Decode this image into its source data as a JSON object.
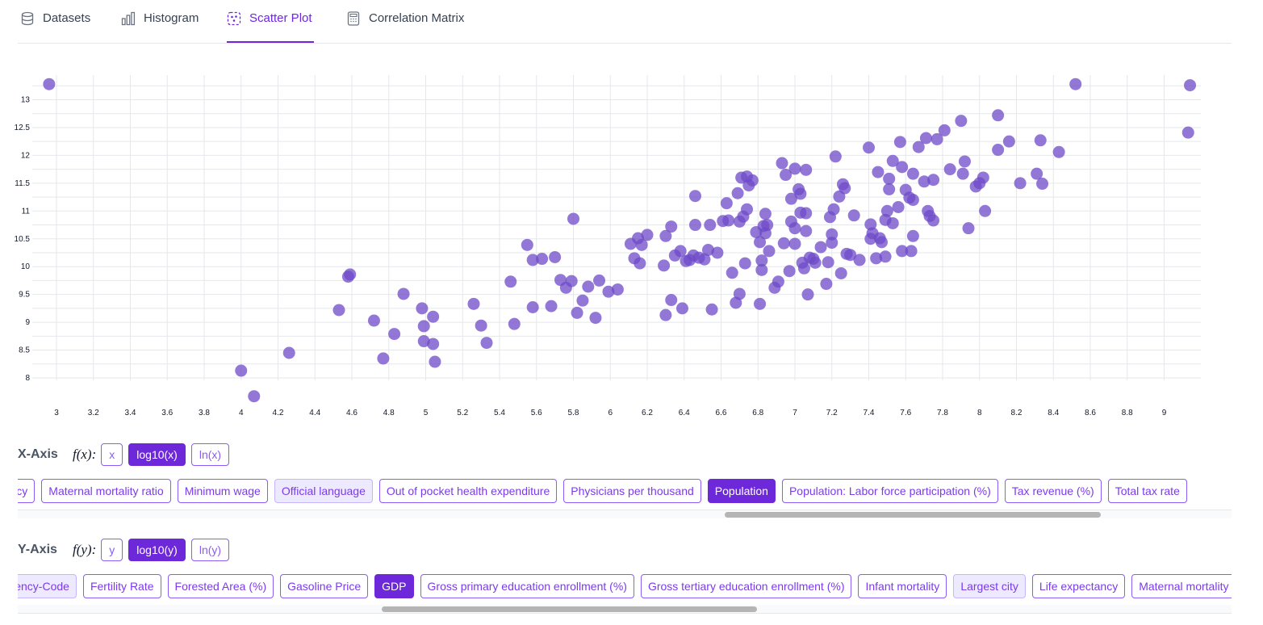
{
  "tabs": [
    {
      "label": "Datasets",
      "icon": "database-icon"
    },
    {
      "label": "Histogram",
      "icon": "bar-chart-icon"
    },
    {
      "label": "Scatter Plot",
      "icon": "scatter-plot-icon",
      "active": true
    },
    {
      "label": "Correlation Matrix",
      "icon": "calculator-icon"
    }
  ],
  "colors": {
    "accent": "#6d28d9",
    "point": "#6d4ac8",
    "chip_border": "#8b5cf6"
  },
  "chart_data": {
    "type": "scatter",
    "title": "",
    "xlabel": "",
    "ylabel": "",
    "xlim": [
      2.95,
      9.15
    ],
    "ylim": [
      7.55,
      13.35
    ],
    "grid": true,
    "x_ticks": [
      "3",
      "3.2",
      "3.4",
      "3.6",
      "3.8",
      "4",
      "4.2",
      "4.4",
      "4.6",
      "4.8",
      "5",
      "5.2",
      "5.4",
      "5.6",
      "5.8",
      "6",
      "6.2",
      "6.4",
      "6.6",
      "6.8",
      "7",
      "7.2",
      "7.4",
      "7.6",
      "7.8",
      "8",
      "8.2",
      "8.4",
      "8.6",
      "8.8",
      "9"
    ],
    "y_ticks": [
      "8",
      "8.5",
      "9",
      "9.5",
      "10",
      "10.5",
      "11",
      "11.5",
      "12",
      "12.5",
      "13"
    ],
    "points": [
      [
        2.96,
        13.28
      ],
      [
        8.52,
        13.28
      ],
      [
        9.14,
        13.26
      ],
      [
        9.13,
        12.41
      ],
      [
        4.0,
        8.13
      ],
      [
        4.07,
        7.67
      ],
      [
        4.26,
        8.45
      ],
      [
        4.53,
        9.22
      ],
      [
        4.58,
        9.82
      ],
      [
        4.59,
        9.86
      ],
      [
        4.72,
        9.03
      ],
      [
        4.77,
        8.35
      ],
      [
        4.83,
        8.79
      ],
      [
        4.88,
        9.51
      ],
      [
        4.98,
        9.25
      ],
      [
        4.99,
        8.93
      ],
      [
        4.99,
        8.66
      ],
      [
        5.04,
        8.61
      ],
      [
        5.04,
        9.1
      ],
      [
        5.05,
        8.29
      ],
      [
        5.26,
        9.33
      ],
      [
        5.3,
        8.94
      ],
      [
        5.33,
        8.63
      ],
      [
        5.46,
        9.73
      ],
      [
        5.48,
        8.97
      ],
      [
        5.55,
        10.39
      ],
      [
        5.58,
        10.12
      ],
      [
        5.58,
        9.27
      ],
      [
        5.63,
        10.14
      ],
      [
        5.68,
        9.29
      ],
      [
        5.7,
        10.17
      ],
      [
        5.73,
        9.76
      ],
      [
        5.76,
        9.62
      ],
      [
        5.79,
        9.74
      ],
      [
        5.8,
        10.86
      ],
      [
        5.82,
        9.17
      ],
      [
        5.85,
        9.39
      ],
      [
        5.88,
        9.64
      ],
      [
        5.92,
        9.08
      ],
      [
        5.94,
        9.75
      ],
      [
        5.99,
        9.55
      ],
      [
        6.04,
        9.59
      ],
      [
        6.11,
        10.41
      ],
      [
        6.13,
        10.15
      ],
      [
        6.15,
        10.51
      ],
      [
        6.16,
        10.06
      ],
      [
        6.17,
        10.39
      ],
      [
        6.2,
        10.57
      ],
      [
        6.29,
        10.02
      ],
      [
        6.3,
        9.13
      ],
      [
        6.3,
        10.55
      ],
      [
        6.33,
        10.72
      ],
      [
        6.33,
        9.4
      ],
      [
        6.35,
        10.2
      ],
      [
        6.38,
        10.28
      ],
      [
        6.39,
        9.25
      ],
      [
        6.41,
        10.1
      ],
      [
        6.43,
        10.12
      ],
      [
        6.45,
        10.2
      ],
      [
        6.46,
        11.27
      ],
      [
        6.46,
        10.75
      ],
      [
        6.48,
        10.16
      ],
      [
        6.51,
        10.13
      ],
      [
        6.53,
        10.3
      ],
      [
        6.54,
        10.75
      ],
      [
        6.55,
        9.23
      ],
      [
        6.58,
        10.25
      ],
      [
        6.61,
        10.82
      ],
      [
        6.63,
        11.14
      ],
      [
        6.64,
        10.83
      ],
      [
        6.66,
        9.89
      ],
      [
        6.68,
        9.35
      ],
      [
        6.69,
        11.32
      ],
      [
        6.7,
        9.51
      ],
      [
        6.7,
        10.81
      ],
      [
        6.71,
        11.6
      ],
      [
        6.72,
        10.9
      ],
      [
        6.73,
        10.06
      ],
      [
        6.74,
        11.62
      ],
      [
        6.74,
        11.03
      ],
      [
        6.75,
        11.46
      ],
      [
        6.77,
        11.55
      ],
      [
        6.79,
        10.62
      ],
      [
        6.81,
        9.33
      ],
      [
        6.81,
        10.44
      ],
      [
        6.82,
        9.94
      ],
      [
        6.82,
        10.11
      ],
      [
        6.83,
        10.73
      ],
      [
        6.84,
        10.95
      ],
      [
        6.84,
        10.6
      ],
      [
        6.85,
        10.75
      ],
      [
        6.86,
        10.28
      ],
      [
        6.89,
        9.62
      ],
      [
        6.91,
        9.73
      ],
      [
        6.93,
        11.86
      ],
      [
        6.94,
        10.42
      ],
      [
        6.95,
        11.65
      ],
      [
        6.97,
        9.92
      ],
      [
        6.98,
        10.81
      ],
      [
        6.98,
        11.22
      ],
      [
        7.0,
        11.76
      ],
      [
        7.0,
        10.69
      ],
      [
        7.0,
        10.41
      ],
      [
        7.02,
        11.39
      ],
      [
        7.03,
        11.31
      ],
      [
        7.03,
        10.97
      ],
      [
        7.04,
        10.07
      ],
      [
        7.05,
        9.97
      ],
      [
        7.06,
        11.74
      ],
      [
        7.06,
        10.64
      ],
      [
        7.06,
        10.96
      ],
      [
        7.07,
        9.5
      ],
      [
        7.08,
        10.16
      ],
      [
        7.1,
        10.14
      ],
      [
        7.11,
        10.07
      ],
      [
        7.14,
        10.35
      ],
      [
        7.17,
        9.69
      ],
      [
        7.18,
        10.08
      ],
      [
        7.19,
        10.89
      ],
      [
        7.2,
        10.43
      ],
      [
        7.2,
        10.58
      ],
      [
        7.21,
        11.03
      ],
      [
        7.22,
        11.98
      ],
      [
        7.24,
        11.26
      ],
      [
        7.25,
        9.88
      ],
      [
        7.26,
        11.48
      ],
      [
        7.27,
        11.41
      ],
      [
        7.28,
        10.23
      ],
      [
        7.3,
        10.21
      ],
      [
        7.32,
        10.92
      ],
      [
        7.35,
        10.12
      ],
      [
        7.4,
        12.14
      ],
      [
        7.41,
        10.5
      ],
      [
        7.41,
        10.76
      ],
      [
        7.42,
        10.6
      ],
      [
        7.44,
        10.15
      ],
      [
        7.45,
        11.7
      ],
      [
        7.46,
        10.51
      ],
      [
        7.47,
        10.44
      ],
      [
        7.49,
        10.18
      ],
      [
        7.49,
        10.84
      ],
      [
        7.5,
        11.0
      ],
      [
        7.51,
        11.39
      ],
      [
        7.51,
        11.58
      ],
      [
        7.53,
        10.78
      ],
      [
        7.53,
        11.9
      ],
      [
        7.56,
        11.07
      ],
      [
        7.57,
        12.24
      ],
      [
        7.58,
        10.28
      ],
      [
        7.58,
        11.79
      ],
      [
        7.6,
        11.38
      ],
      [
        7.62,
        11.24
      ],
      [
        7.63,
        10.28
      ],
      [
        7.64,
        11.2
      ],
      [
        7.64,
        10.55
      ],
      [
        7.64,
        11.67
      ],
      [
        7.67,
        12.15
      ],
      [
        7.7,
        11.53
      ],
      [
        7.71,
        12.31
      ],
      [
        7.72,
        11.0
      ],
      [
        7.73,
        10.91
      ],
      [
        7.75,
        10.83
      ],
      [
        7.75,
        11.56
      ],
      [
        7.77,
        12.29
      ],
      [
        7.81,
        12.45
      ],
      [
        7.84,
        11.75
      ],
      [
        7.9,
        12.62
      ],
      [
        7.91,
        11.67
      ],
      [
        7.92,
        11.89
      ],
      [
        7.94,
        10.69
      ],
      [
        7.98,
        11.44
      ],
      [
        8.0,
        11.5
      ],
      [
        8.02,
        11.6
      ],
      [
        8.03,
        11.0
      ],
      [
        8.1,
        12.1
      ],
      [
        8.1,
        12.72
      ],
      [
        8.16,
        12.25
      ],
      [
        8.22,
        11.5
      ],
      [
        8.31,
        11.67
      ],
      [
        8.33,
        12.27
      ],
      [
        8.34,
        11.49
      ],
      [
        8.43,
        12.06
      ]
    ]
  },
  "x_axis": {
    "title": "X-Axis",
    "fx": "f(x):",
    "functions": [
      {
        "label": "x"
      },
      {
        "label": "log10(x)",
        "active": true
      },
      {
        "label": "ln(x)"
      }
    ],
    "chips": [
      {
        "label": "Life expectancy"
      },
      {
        "label": "Maternal mortality ratio"
      },
      {
        "label": "Minimum wage"
      },
      {
        "label": "Official language",
        "muted": true
      },
      {
        "label": "Out of pocket health expenditure"
      },
      {
        "label": "Physicians per thousand"
      },
      {
        "label": "Population",
        "active": true
      },
      {
        "label": "Population: Labor force participation (%)"
      },
      {
        "label": "Tax revenue (%)"
      },
      {
        "label": "Total tax rate"
      }
    ]
  },
  "y_axis": {
    "title": "Y-Axis",
    "fy": "f(y):",
    "functions": [
      {
        "label": "y"
      },
      {
        "label": "log10(y)",
        "active": true
      },
      {
        "label": "ln(y)"
      }
    ],
    "chips": [
      {
        "label": "Currency-Code",
        "muted": true
      },
      {
        "label": "Fertility Rate"
      },
      {
        "label": "Forested Area (%)"
      },
      {
        "label": "Gasoline Price"
      },
      {
        "label": "GDP",
        "active": true
      },
      {
        "label": "Gross primary education enrollment (%)"
      },
      {
        "label": "Gross tertiary education enrollment (%)"
      },
      {
        "label": "Infant mortality"
      },
      {
        "label": "Largest city",
        "muted": true
      },
      {
        "label": "Life expectancy"
      },
      {
        "label": "Maternal mortality ratio"
      }
    ]
  }
}
